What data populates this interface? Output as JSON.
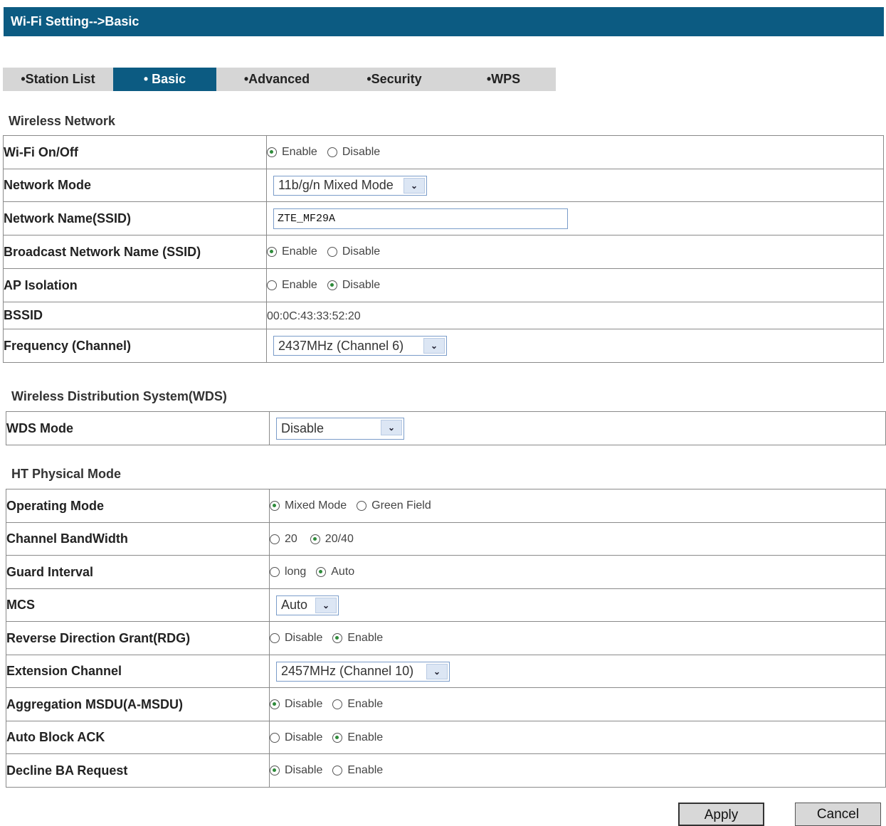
{
  "header": {
    "title": "Wi-Fi Setting-->Basic"
  },
  "tabs": [
    {
      "label": "•Station List"
    },
    {
      "label": "• Basic"
    },
    {
      "label": "•Advanced"
    },
    {
      "label": "•Security"
    },
    {
      "label": "•WPS"
    }
  ],
  "wireless": {
    "title": "Wireless Network",
    "wifi_onoff": {
      "label": "Wi-Fi On/Off",
      "opt1": "Enable",
      "opt2": "Disable",
      "selected": "Enable"
    },
    "network_mode": {
      "label": "Network Mode",
      "value": "11b/g/n Mixed Mode"
    },
    "ssid": {
      "label": "Network Name(SSID)",
      "value": "ZTE_MF29A"
    },
    "broadcast": {
      "label": "Broadcast Network Name (SSID)",
      "opt1": "Enable",
      "opt2": "Disable",
      "selected": "Enable"
    },
    "ap_isolation": {
      "label": "AP Isolation",
      "opt1": "Enable",
      "opt2": "Disable",
      "selected": "Disable"
    },
    "bssid": {
      "label": "BSSID",
      "value": "00:0C:43:33:52:20"
    },
    "frequency": {
      "label": "Frequency (Channel)",
      "value": "2437MHz (Channel 6)"
    }
  },
  "wds": {
    "title": "Wireless Distribution System(WDS)",
    "mode": {
      "label": "WDS Mode",
      "value": "Disable"
    }
  },
  "ht": {
    "title": "HT Physical Mode",
    "operating_mode": {
      "label": "Operating Mode",
      "opt1": "Mixed Mode",
      "opt2": "Green Field",
      "selected": "Mixed Mode"
    },
    "bandwidth": {
      "label": "Channel BandWidth",
      "opt1": "20",
      "opt2": "20/40",
      "selected": "20/40"
    },
    "guard": {
      "label": "Guard Interval",
      "opt1": "long",
      "opt2": "Auto",
      "selected": "Auto"
    },
    "mcs": {
      "label": "MCS",
      "value": "Auto"
    },
    "rdg": {
      "label": "Reverse Direction Grant(RDG)",
      "opt1": "Disable",
      "opt2": "Enable",
      "selected": "Enable"
    },
    "ext_channel": {
      "label": "Extension Channel",
      "value": "2457MHz (Channel 10)"
    },
    "amsdu": {
      "label": "Aggregation MSDU(A-MSDU)",
      "opt1": "Disable",
      "opt2": "Enable",
      "selected": "Disable"
    },
    "auto_block_ack": {
      "label": "Auto Block ACK",
      "opt1": "Disable",
      "opt2": "Enable",
      "selected": "Enable"
    },
    "decline_ba": {
      "label": "Decline BA Request",
      "opt1": "Disable",
      "opt2": "Enable",
      "selected": "Disable"
    }
  },
  "buttons": {
    "apply": "Apply",
    "cancel": "Cancel"
  },
  "colors": {
    "header_bg": "#0c5b82",
    "tab_bar_bg": "#d6d6d6",
    "radio_dot": "#2e8b3a"
  }
}
